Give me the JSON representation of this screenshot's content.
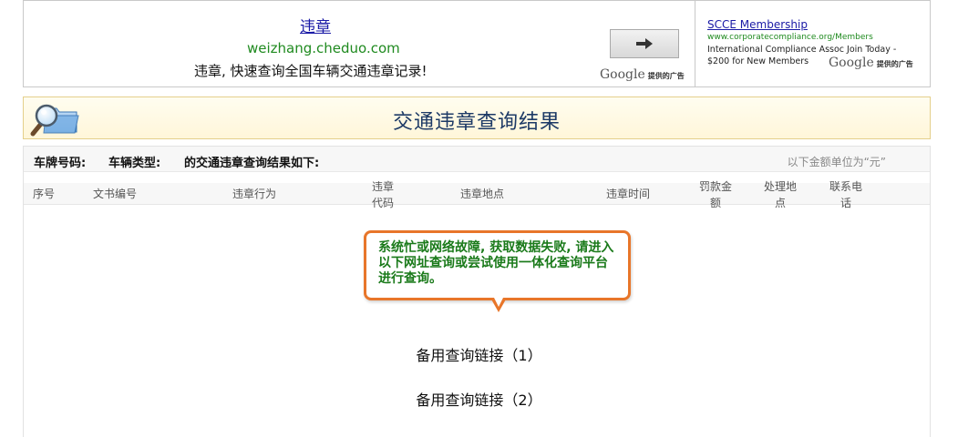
{
  "ad_left": {
    "title": "违章",
    "url": "weizhang.cheduo.com",
    "description": "违章, 快速查询全国车辆交通违章记录!",
    "brand_google": "Google",
    "brand_suffix": "提供的广告"
  },
  "ad_right": {
    "title": "SCCE Membership",
    "url": "www.corporatecompliance.org/Members",
    "description": "International Compliance Assoc Join Today - $200 for New Members",
    "brand_google": "Google",
    "brand_suffix": "提供的广告"
  },
  "page_title": "交通违章查询结果",
  "info": {
    "plate_label": "车牌号码:",
    "type_label": "车辆类型:",
    "result_label": "的交通违章查询结果如下:",
    "unit_note": "以下金额单位为“元”"
  },
  "columns": [
    "序号",
    "文书编号",
    "违章行为",
    "违章代码",
    "违章地点",
    "违章时间",
    "罚款金额",
    "处理地点",
    "联系电话"
  ],
  "error_message": "系统忙或网络故障, 获取数据失败, 请进入以下网址查询或尝试使用一体化查询平台进行查询。",
  "links": [
    "备用查询链接（1）",
    "备用查询链接（2）"
  ],
  "colors": {
    "ad_link": "#1a1aa6",
    "ad_url": "#1f8a1f",
    "title": "#1d3a66",
    "bubble_border": "#e8762a",
    "bubble_text": "#1a7a1a"
  },
  "icons": {
    "ad_arrow": "arrow-right-icon",
    "title": "magnifier-folder-icon"
  }
}
